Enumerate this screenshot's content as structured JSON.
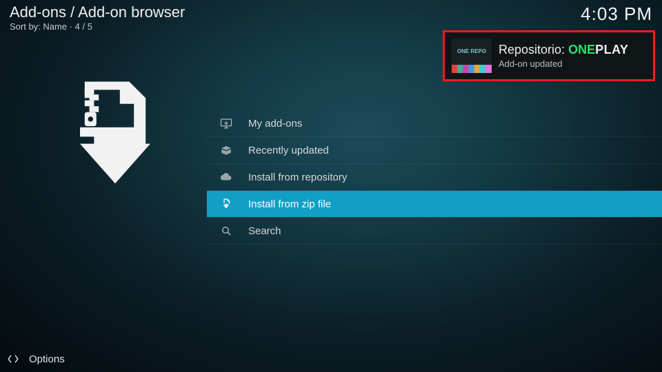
{
  "header": {
    "breadcrumb": "Add-ons / Add-on browser",
    "sort_prefix": "Sort by: ",
    "sort_value": "Name",
    "sort_sep": "  ·  ",
    "position": "4 / 5",
    "clock": "4:03 PM"
  },
  "menu": {
    "items": [
      {
        "label": "My add-ons",
        "icon": "monitor-icon"
      },
      {
        "label": "Recently updated",
        "icon": "box-open-icon"
      },
      {
        "label": "Install from repository",
        "icon": "cloud-down-icon"
      },
      {
        "label": "Install from zip file",
        "icon": "zip-file-icon"
      },
      {
        "label": "Search",
        "icon": "search-icon"
      }
    ],
    "selected_index": 3
  },
  "notification": {
    "title_prefix": "Repositorio: ",
    "title_accent1": "ONE",
    "title_accent2": "PLAY",
    "subtitle": "Add-on updated",
    "thumb_text": "ONE REPO"
  },
  "footer": {
    "options_label": "Options"
  },
  "colors": {
    "highlight": "#129fc5",
    "annotation_border": "#ff1a1a",
    "accent_green": "#2ee06a"
  }
}
